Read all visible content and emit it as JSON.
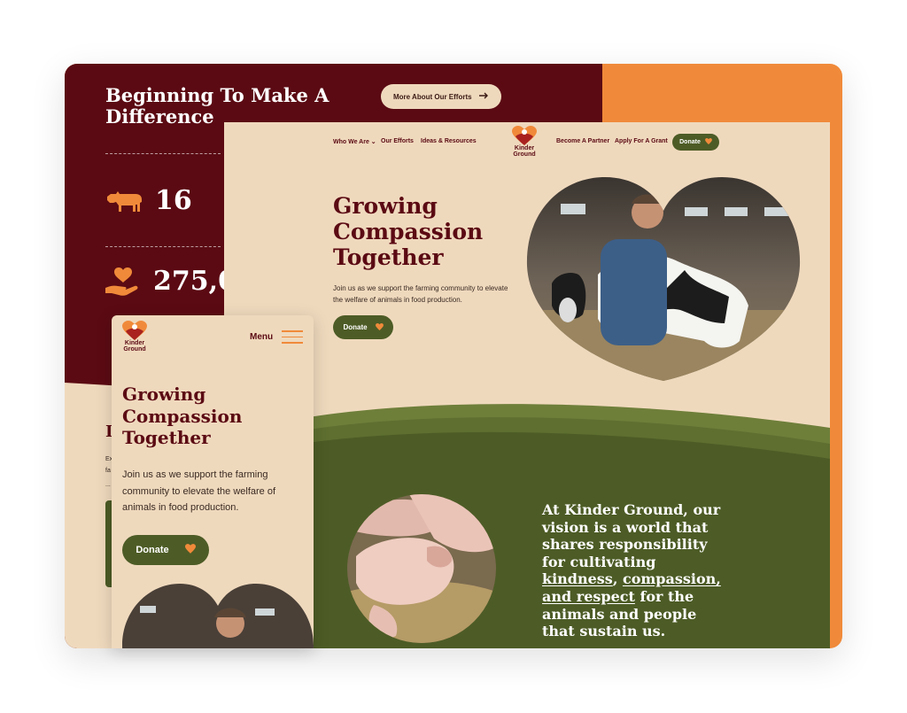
{
  "colors": {
    "maroon": "#5b0a13",
    "orange": "#f08a3a",
    "cream": "#efd9bd",
    "olive": "#4d5c26"
  },
  "back_page": {
    "title": "Beginning To Make A Difference",
    "button_label": "More About Our Efforts",
    "stats": [
      {
        "icon": "cow-icon",
        "value": "16"
      },
      {
        "icon": "heart-hand-icon",
        "value": "275,0"
      }
    ],
    "partial_heading": "I",
    "partial_lines": [
      "Ex",
      "fa",
      "..."
    ]
  },
  "desktop": {
    "nav": {
      "items": [
        "Who We Are",
        "Our Efforts",
        "Ideas & Resources"
      ],
      "right_items": [
        "Become A Partner",
        "Apply For A Grant"
      ],
      "donate_label": "Donate",
      "logo_text_1": "Kinder",
      "logo_text_2": "Ground"
    },
    "hero": {
      "title_lines": [
        "Growing",
        "Compassion",
        "Together"
      ],
      "subtitle": "Join us as we support the farming community to elevate the welfare of animals in food production.",
      "donate_label": "Donate"
    },
    "vision": {
      "part1": "At Kinder Ground, our vision is a world that shares responsibility for cultivating ",
      "link1": "kindness",
      "sep1": ", ",
      "link2": "compassion, and respect",
      "part2": " for the animals and people that sustain us."
    }
  },
  "mobile": {
    "logo_text_1": "Kinder",
    "logo_text_2": "Ground",
    "menu_label": "Menu",
    "title_lines": [
      "Growing",
      "Compassion",
      "Together"
    ],
    "subtitle": "Join us as we support the farming community to elevate the welfare of animals in food production.",
    "donate_label": "Donate"
  }
}
